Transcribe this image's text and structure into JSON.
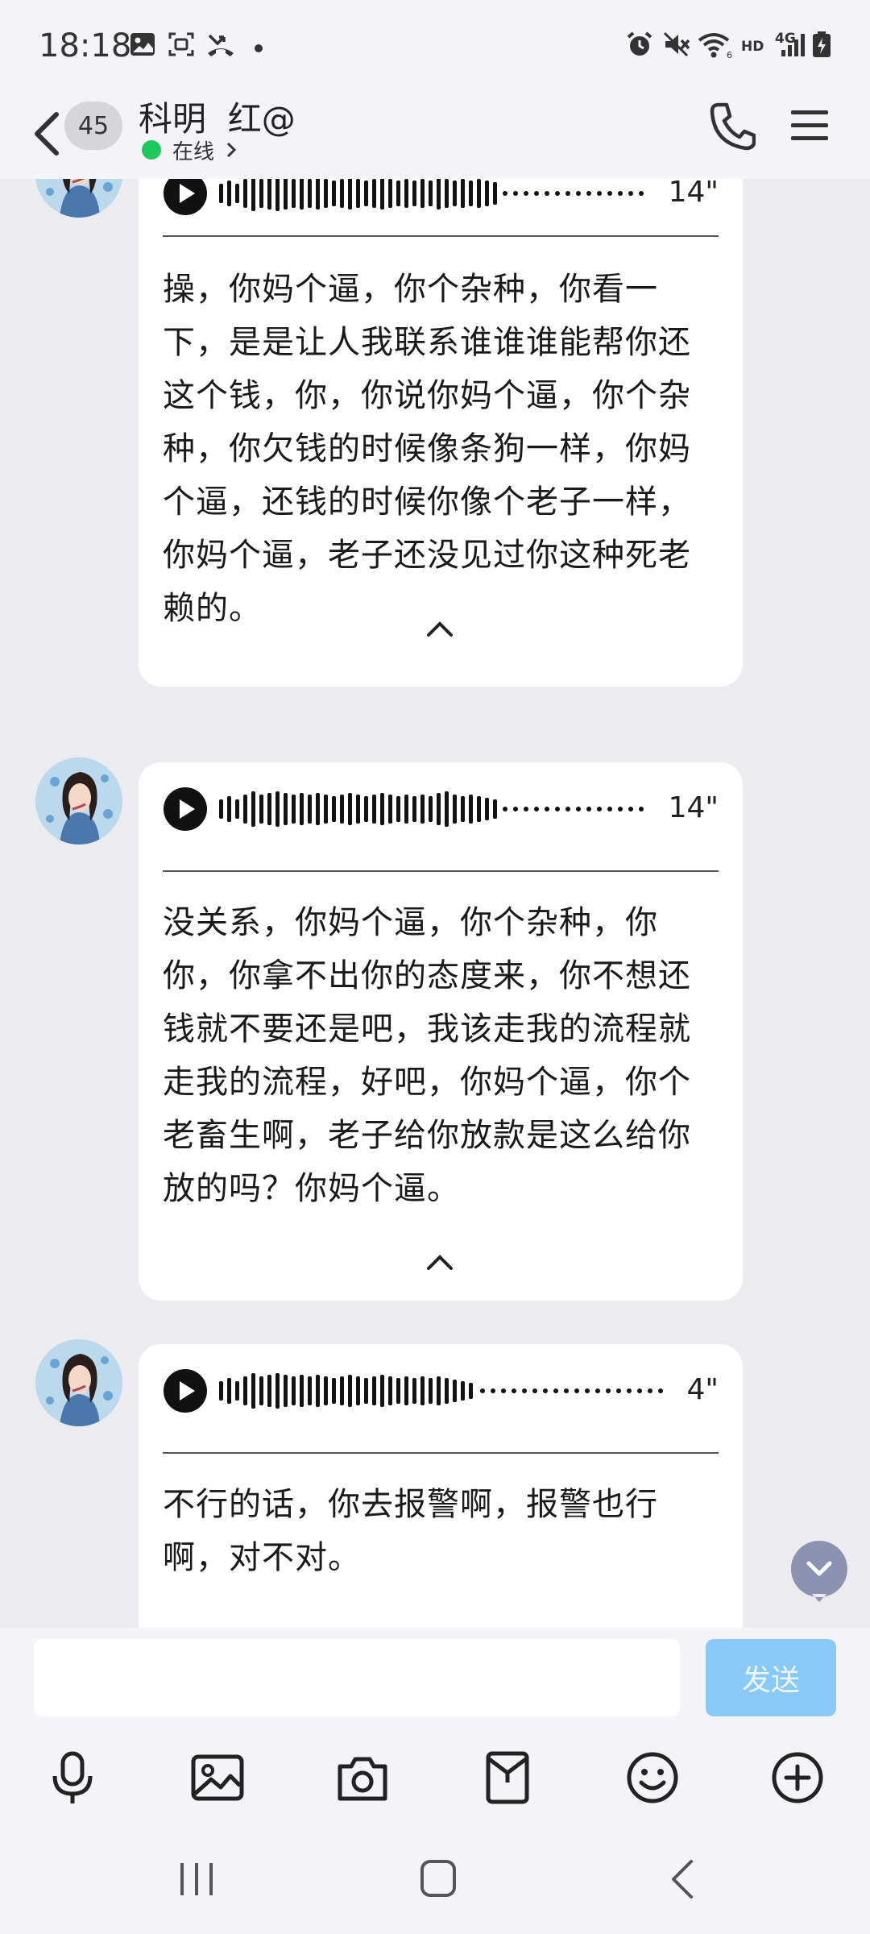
{
  "status_bar": {
    "time": "18:18",
    "network_label": "4G",
    "hd_label": "HD"
  },
  "header": {
    "unread_count": "45",
    "title": "科明  红@",
    "status": "在线"
  },
  "messages": [
    {
      "duration": "14\"",
      "transcript": "操，你妈个逼，你个杂种，你看一下，是是让人我联系谁谁谁能帮你还这个钱，你，你说你妈个逼，你个杂种，你欠钱的时候像条狗一样，你妈个逼，还钱的时候你像个老子一样，你妈个逼，老子还没见过你这种死老赖的。"
    },
    {
      "duration": "14\"",
      "transcript": "没关系，你妈个逼，你个杂种，你你，你拿不出你的态度来，你不想还钱就不要还是吧，我该走我的流程就走我的流程，好吧，你妈个逼，你个老畜生啊，老子给你放款是这么给你放的吗？你妈个逼。"
    },
    {
      "duration": "4\"",
      "transcript": "不行的话，你去报警啊，报警也行啊，对不对。"
    }
  ],
  "input": {
    "value": "",
    "send_label": "发送"
  },
  "toolbar": [
    "microphone-icon",
    "image-icon",
    "camera-icon",
    "red-packet-icon",
    "emoji-icon",
    "plus-icon"
  ],
  "colors": {
    "background": "#ececf0",
    "online": "#1ec85d",
    "send_button": "#8ac8f7",
    "scroll_button": "#8c93b2"
  }
}
